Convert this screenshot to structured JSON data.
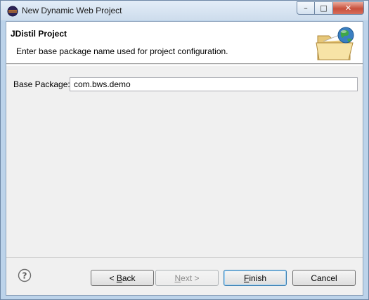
{
  "window": {
    "title": "New Dynamic Web Project",
    "controls": {
      "minimize": "–",
      "maximize": "□",
      "close": "✕"
    }
  },
  "banner": {
    "title": "JDistil Project",
    "description": "Enter base package name used for project configuration.",
    "icon": "folder-globe-icon"
  },
  "form": {
    "base_package_label": "Base Package:",
    "base_package_value": "com.bws.demo"
  },
  "buttons": {
    "help_icon": "help-icon",
    "back_mnemonic": "B",
    "back_rest": "ack",
    "back_prefix": "< ",
    "next_mnemonic": "N",
    "next_rest": "ext >",
    "finish_mnemonic": "F",
    "finish_rest": "inish",
    "cancel": "Cancel"
  },
  "colors": {
    "accent": "#3c7fb1",
    "titlebar": "#cddcec",
    "close": "#c8503c"
  }
}
